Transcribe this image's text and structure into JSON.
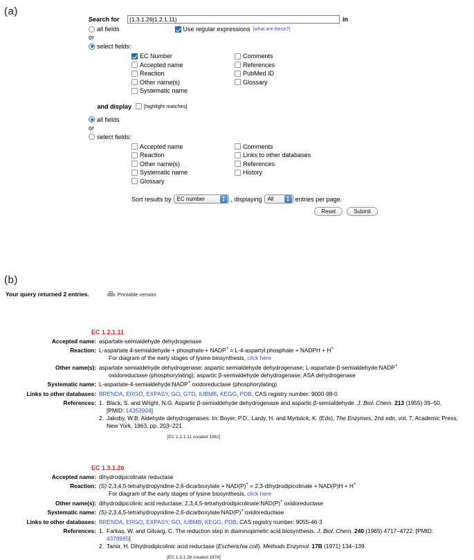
{
  "panels": {
    "a_label": "(a)",
    "b_label": "(b)"
  },
  "search_form": {
    "search_for_label": "Search for",
    "search_value": "(1.3.1.26|1.2.1.11)",
    "search_placeholder": "",
    "in_label": "in",
    "scope_all_fields_label": "all fields",
    "or_label": "or",
    "scope_select_fields_label": "select fields:",
    "regex_label": "Use regular expressions",
    "regex_help_link": "[what are these?]",
    "search_fields_col1": [
      {
        "label": "EC Number",
        "checked": true
      },
      {
        "label": "Accepted name",
        "checked": false
      },
      {
        "label": "Reaction",
        "checked": false
      },
      {
        "label": "Other name(s)",
        "checked": false
      },
      {
        "label": "Systematic name",
        "checked": false
      }
    ],
    "search_fields_col2": [
      {
        "label": "Comments",
        "checked": false
      },
      {
        "label": "References",
        "checked": false
      },
      {
        "label": "PubMed ID",
        "checked": false
      },
      {
        "label": "Glossary",
        "checked": false
      }
    ],
    "and_display_label": "and display",
    "highlight_matches_label": "[highlight matches]",
    "display_all_fields_label": "all fields",
    "display_or_label": "or",
    "display_select_fields_label": "select fields:",
    "display_fields_col1": [
      {
        "label": "Accepted name",
        "checked": false
      },
      {
        "label": "Reaction",
        "checked": false
      },
      {
        "label": "Other name(s)",
        "checked": false
      },
      {
        "label": "Systematic name",
        "checked": false
      },
      {
        "label": "Glossary",
        "checked": false
      }
    ],
    "display_fields_col2": [
      {
        "label": "Comments",
        "checked": false
      },
      {
        "label": "Links to other databases",
        "checked": false
      },
      {
        "label": "References",
        "checked": false
      },
      {
        "label": "History",
        "checked": false
      }
    ],
    "sort_prefix": "Sort results by",
    "sort_value": "EC number",
    "sort_middle": ", displaying",
    "per_page_value": "All",
    "sort_suffix": "entries per page.",
    "reset_label": "Reset",
    "submit_label": "Submit"
  },
  "results": {
    "query_status": "Your query returned 2 entries.",
    "printable_label": "Printable version",
    "labels": {
      "accepted_name": "Accepted name:",
      "reaction": "Reaction:",
      "other_names": "Other name(s):",
      "systematic_name": "Systematic name:",
      "links": "Links to other databases:",
      "references": "References:"
    },
    "entries": [
      {
        "ec": "EC 1.2.1.11",
        "accepted_name": "aspartate-semialdehyde dehydrogenase",
        "reaction": "L-aspartate 4-semialdehyde + phosphate + NADP",
        "reaction_sup": "+",
        "reaction_tail": " = L-4-aspartyl phosphate + NADPH + H",
        "reaction_tail_sup": "+",
        "diagram_text": "For diagram of the early stages of lysine biosynthesis, ",
        "diagram_link": "click here",
        "other_names_1": "aspartate semialdehyde dehydrogenase; aspartic semialdehyde dehydrogenase; L-aspartate-β-semialdehyde:NADP",
        "other_names_1_sup": "+",
        "other_names_2": "oxidoreductase (phosphorylating); aspartic β-semialdehyde dehydrogenase; ASA dehydrogenase",
        "systematic_name": "L-aspartate-4-semialdehyde:NADP",
        "systematic_name_sup": "+",
        "systematic_name_tail": " oxidoreductase (phosphorylating)",
        "db_links": [
          "BRENDA",
          "ERGO",
          "EXPASY",
          "GO",
          "GTD",
          "IUBMB",
          "KEGG",
          "PDB"
        ],
        "cas_label": "CAS registry number:",
        "cas_value": "9000-98-0",
        "references": [
          {
            "num": "1.",
            "text_a": "Black, S. and Wright, N.G. Aspartic β-semialdehyde dehydrogenase and aspartic β-semialdehyde. ",
            "journal": "J. Biol. Chem.",
            "volume": "213",
            "text_b": " (1955) 39–50. [PMID: ",
            "pmid": "14353904",
            "text_c": "]"
          },
          {
            "num": "2.",
            "text_a": "Jakoby, W.B. Aldehyde dehydrogenases. In: Boyer, P.D., Lardy, H. and Myrbäck, K. (Eds), ",
            "journal": "The Enzymes",
            "volume": "",
            "text_b": ", 2nd edn, vol. 7, Academic Press, New York, 1963, pp. 203–221.",
            "pmid": "",
            "text_c": ""
          }
        ],
        "created_note": "[EC 1.2.1.11 created 1961]"
      },
      {
        "ec": "EC 1.3.1.26",
        "accepted_name": "dihydrodipicolinate reductase",
        "reaction_italic": "(S)",
        "reaction": "-2,3,4,5-tetrahydropyridine-2,6-dicarboxylate + NAD(P)",
        "reaction_sup": "+",
        "reaction_tail": " = 2,3-dihydrodipicolinate + NAD(P)H + H",
        "reaction_tail_sup": "+",
        "diagram_text": "For diagram of the early stages of lysine biosynthesis, ",
        "diagram_link": "click here",
        "other_names_1": "dihydrodipicolinic acid reductase; 2,3,4,5-tetrahydrodipicolinate:NAD(P)",
        "other_names_1_sup": "+",
        "other_names_2": " oxidoreductase",
        "systematic_name_italic": "(S)",
        "systematic_name": "-2,3,4,5-tetrahydropyridine-2,6-dicarboxylate:NAD(P)",
        "systematic_name_sup": "+",
        "systematic_name_tail": " oxidoreductase",
        "db_links": [
          "BRENDA",
          "ERGO",
          "EXPASY",
          "GO",
          "IUBMB",
          "KEGG",
          "PDB"
        ],
        "cas_label": "CAS registry number:",
        "cas_value": "9055-46-3",
        "references": [
          {
            "num": "1.",
            "text_a": "Farkas, W. and Gilvarg, C. The reduction step in diaminopimelic acid biosynthesis. ",
            "journal": "J. Biol. Chem.",
            "volume": "240",
            "text_b": " (1965) 4717–4722. [PMID: ",
            "pmid": "4378965",
            "text_c": "]"
          },
          {
            "num": "2.",
            "text_a": "Tamir, H. Dihydrodipicolinic acid reductase (",
            "journal": "Methods Enzymol.",
            "volume": "17B",
            "text_b": " (1971) 134–139.",
            "pmid": "",
            "text_c": "",
            "species_italic": "Escherichia coli",
            "text_mid": "). "
          }
        ],
        "created_note": "[EC 1.3.1.26 created 1976]"
      }
    ]
  },
  "colors": {
    "ec_red": "#e8231f",
    "link_blue": "#2a52c8",
    "accent_blue": "#2f6bb5"
  }
}
